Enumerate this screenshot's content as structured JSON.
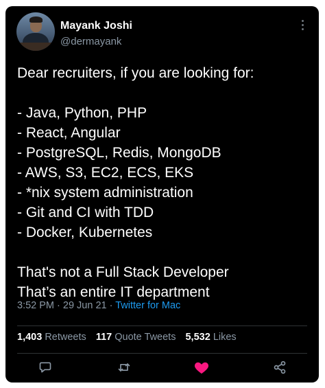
{
  "author": {
    "name": "Mayank Joshi",
    "handle": "@dermayank"
  },
  "tweet": {
    "lines": [
      "Dear recruiters, if you are looking for:",
      "",
      "- Java, Python, PHP",
      "- React, Angular",
      "- PostgreSQL, Redis, MongoDB",
      "- AWS, S3, EC2, ECS, EKS",
      "- *nix system administration",
      "- Git and CI with TDD",
      "- Docker, Kubernetes",
      "",
      "That's not a Full Stack Developer",
      "That’s an entire IT department"
    ]
  },
  "meta": {
    "time": "3:52 PM",
    "sep1": " · ",
    "date": "29 Jun 21",
    "sep2": " · ",
    "source": "Twitter for Mac"
  },
  "stats": {
    "retweets": {
      "count": "1,403",
      "label": "Retweets"
    },
    "quotes": {
      "count": "117",
      "label": "Quote Tweets"
    },
    "likes": {
      "count": "5,532",
      "label": "Likes"
    }
  },
  "actions": {
    "reply_icon": "reply-icon",
    "retweet_icon": "retweet-icon",
    "like_icon": "heart-icon",
    "like_active": true,
    "share_icon": "share-icon"
  },
  "colors": {
    "background": "#000000",
    "text": "#ffffff",
    "muted": "#8b98a5",
    "link": "#1d9bf0",
    "like": "#f91880",
    "icon": "#8b98a5"
  }
}
